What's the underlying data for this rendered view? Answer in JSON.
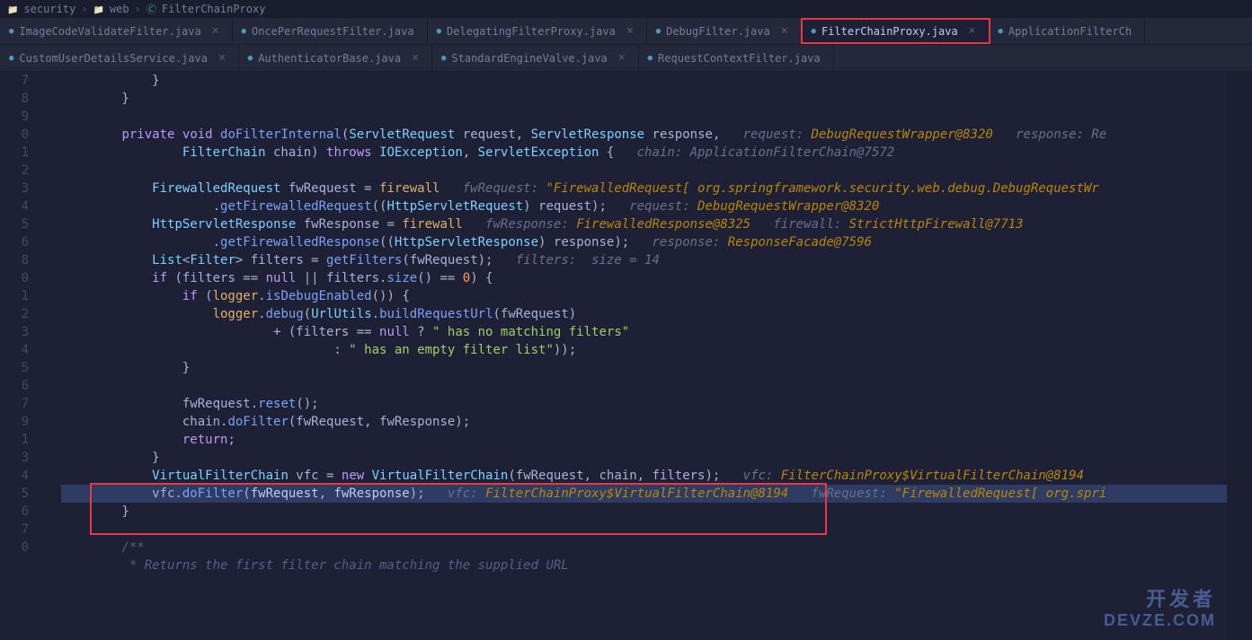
{
  "breadcrumbs": [
    "security",
    "web",
    "FilterChainProxy"
  ],
  "tabs_row1": [
    {
      "label": "ImageCodeValidateFilter.java",
      "active": false,
      "closable": true
    },
    {
      "label": "OncePerRequestFilter.java",
      "active": false,
      "closable": false
    },
    {
      "label": "DelegatingFilterProxy.java",
      "active": false,
      "closable": true
    },
    {
      "label": "DebugFilter.java",
      "active": false,
      "closable": true
    },
    {
      "label": "FilterChainProxy.java",
      "active": true,
      "closable": true,
      "highlighted": true
    },
    {
      "label": "ApplicationFilterCh",
      "active": false,
      "closable": false
    }
  ],
  "tabs_row2": [
    {
      "label": "CustomUserDetailsService.java",
      "active": false,
      "closable": true
    },
    {
      "label": "AuthenticatorBase.java",
      "active": false,
      "closable": true
    },
    {
      "label": "StandardEngineValve.java",
      "active": false,
      "closable": true
    },
    {
      "label": "RequestContextFilter.java",
      "active": false,
      "closable": false
    }
  ],
  "gutter_lines": [
    "7",
    "8",
    "9",
    "0",
    "1",
    "2",
    "3",
    "4",
    "5",
    "6",
    "8",
    "0",
    "1",
    "2",
    "3",
    "4",
    "5",
    "6",
    "7",
    "9",
    "1",
    "3",
    "4",
    "5",
    "6",
    "7",
    "0"
  ],
  "code_lines": [
    {
      "raw": "            }"
    },
    {
      "raw": "        }"
    },
    {
      "raw": ""
    },
    {
      "seg": [
        [
          "        ",
          ""
        ],
        [
          "private",
          "kw"
        ],
        [
          " ",
          ""
        ],
        [
          "void",
          "kw"
        ],
        [
          " ",
          ""
        ],
        [
          "doFilterInternal",
          "fn"
        ],
        [
          "(",
          ""
        ],
        [
          "ServletRequest",
          "type"
        ],
        [
          " request, ",
          ""
        ],
        [
          "ServletResponse",
          "type"
        ],
        [
          " response,   ",
          ""
        ],
        [
          "request: ",
          "hint"
        ],
        [
          "DebugRequestWrapper@8320   ",
          "hintval"
        ],
        [
          "response: Re",
          "hint"
        ]
      ]
    },
    {
      "seg": [
        [
          "                ",
          ""
        ],
        [
          "FilterChain",
          "type"
        ],
        [
          " chain) ",
          ""
        ],
        [
          "throws",
          "kw"
        ],
        [
          " ",
          ""
        ],
        [
          "IOException",
          "type"
        ],
        [
          ", ",
          ""
        ],
        [
          "ServletException",
          "type"
        ],
        [
          " {   ",
          ""
        ],
        [
          "chain: ApplicationFilterChain@7572",
          "hint"
        ]
      ]
    },
    {
      "raw": ""
    },
    {
      "seg": [
        [
          "            ",
          ""
        ],
        [
          "FirewalledRequest",
          "type"
        ],
        [
          " fwRequest = ",
          ""
        ],
        [
          "firewall   ",
          "field"
        ],
        [
          "fwRequest: ",
          "hint"
        ],
        [
          "\"FirewalledRequest[ org.springframework.security.web.debug.DebugRequestWr",
          "hintval"
        ]
      ]
    },
    {
      "seg": [
        [
          "                    .",
          ""
        ],
        [
          "getFirewalledRequest",
          "fn"
        ],
        [
          "((",
          ""
        ],
        [
          "HttpServletRequest",
          "type"
        ],
        [
          ") request);   ",
          ""
        ],
        [
          "request: ",
          "hint"
        ],
        [
          "DebugRequestWrapper@8320",
          "hintval"
        ]
      ]
    },
    {
      "seg": [
        [
          "            ",
          ""
        ],
        [
          "HttpServletResponse",
          "type"
        ],
        [
          " fwResponse = ",
          ""
        ],
        [
          "firewall   ",
          "field"
        ],
        [
          "fwResponse: ",
          "hint"
        ],
        [
          "FirewalledResponse@8325   ",
          "hintval"
        ],
        [
          "firewall: ",
          "hint"
        ],
        [
          "StrictHttpFirewall@7713",
          "hintval"
        ]
      ]
    },
    {
      "seg": [
        [
          "                    .",
          ""
        ],
        [
          "getFirewalledResponse",
          "fn"
        ],
        [
          "((",
          ""
        ],
        [
          "HttpServletResponse",
          "type"
        ],
        [
          ") response);   ",
          ""
        ],
        [
          "response: ",
          "hint"
        ],
        [
          "ResponseFacade@7596",
          "hintval"
        ]
      ]
    },
    {
      "seg": [
        [
          "            ",
          ""
        ],
        [
          "List",
          "type"
        ],
        [
          "<",
          ""
        ],
        [
          "Filter",
          "type"
        ],
        [
          "> filters = ",
          ""
        ],
        [
          "getFilters",
          "fn"
        ],
        [
          "(fwRequest);   ",
          ""
        ],
        [
          "filters:  size = 14",
          "hint"
        ]
      ]
    },
    {
      "seg": [
        [
          "            ",
          ""
        ],
        [
          "if",
          "kw"
        ],
        [
          " (filters == ",
          ""
        ],
        [
          "null",
          "kw"
        ],
        [
          " || filters.",
          ""
        ],
        [
          "size",
          "fn"
        ],
        [
          "() == ",
          ""
        ],
        [
          "0",
          "num"
        ],
        [
          ") {",
          ""
        ]
      ]
    },
    {
      "seg": [
        [
          "                ",
          ""
        ],
        [
          "if",
          "kw"
        ],
        [
          " (",
          ""
        ],
        [
          "logger",
          "field"
        ],
        [
          ".",
          ""
        ],
        [
          "isDebugEnabled",
          "fn"
        ],
        [
          "()) {",
          ""
        ]
      ]
    },
    {
      "seg": [
        [
          "                    ",
          ""
        ],
        [
          "logger",
          "field"
        ],
        [
          ".",
          ""
        ],
        [
          "debug",
          "fn"
        ],
        [
          "(",
          ""
        ],
        [
          "UrlUtils",
          "type"
        ],
        [
          ".",
          ""
        ],
        [
          "buildRequestUrl",
          "fn"
        ],
        [
          "(fwRequest)",
          ""
        ]
      ]
    },
    {
      "seg": [
        [
          "                            + (filters == ",
          ""
        ],
        [
          "null",
          "kw"
        ],
        [
          " ? ",
          ""
        ],
        [
          "\" has no matching filters\"",
          "str"
        ]
      ]
    },
    {
      "seg": [
        [
          "                                    : ",
          ""
        ],
        [
          "\" has an empty filter list\"",
          "str"
        ],
        [
          "));",
          ""
        ]
      ]
    },
    {
      "raw": "                }"
    },
    {
      "raw": ""
    },
    {
      "seg": [
        [
          "                fwRequest.",
          ""
        ],
        [
          "reset",
          "fn"
        ],
        [
          "();",
          ""
        ]
      ]
    },
    {
      "seg": [
        [
          "                chain.",
          ""
        ],
        [
          "doFilter",
          "fn"
        ],
        [
          "(fwRequest, fwResponse);",
          ""
        ]
      ]
    },
    {
      "seg": [
        [
          "                ",
          ""
        ],
        [
          "return",
          "kw"
        ],
        [
          ";",
          ""
        ]
      ]
    },
    {
      "raw": "            }"
    },
    {
      "seg": [
        [
          "            ",
          ""
        ],
        [
          "VirtualFilterChain",
          "type"
        ],
        [
          " vfc = ",
          ""
        ],
        [
          "new",
          "kw"
        ],
        [
          " ",
          ""
        ],
        [
          "VirtualFilterChain",
          "type"
        ],
        [
          "(fwRequest, chain, filters);   ",
          ""
        ],
        [
          "vfc: ",
          "hint"
        ],
        [
          "FilterChainProxy$VirtualFilterChain@8194   ",
          "hintval"
        ]
      ]
    },
    {
      "hl": true,
      "seg": [
        [
          "            vfc.",
          ""
        ],
        [
          "doFilter",
          "fn"
        ],
        [
          "(",
          ""
        ],
        [
          "fwRequest",
          "var"
        ],
        [
          ", ",
          ""
        ],
        [
          "fwResponse",
          "var"
        ],
        [
          ");   ",
          ""
        ],
        [
          "vfc: ",
          "hint"
        ],
        [
          "FilterChainProxy$VirtualFilterChain@8194   ",
          "hintval"
        ],
        [
          "fwRequest: ",
          "hint"
        ],
        [
          "\"FirewalledRequest[ org.spri",
          "hintval"
        ]
      ]
    },
    {
      "raw": "        }"
    },
    {
      "raw": ""
    },
    {
      "seg": [
        [
          "        ",
          ""
        ],
        [
          "/**",
          "comment"
        ]
      ]
    },
    {
      "seg": [
        [
          "         * Returns the first filter chain matching the supplied URL",
          "comment"
        ]
      ]
    }
  ],
  "watermark": {
    "line1": "开发者",
    "line2": "DEVZE.COM"
  }
}
